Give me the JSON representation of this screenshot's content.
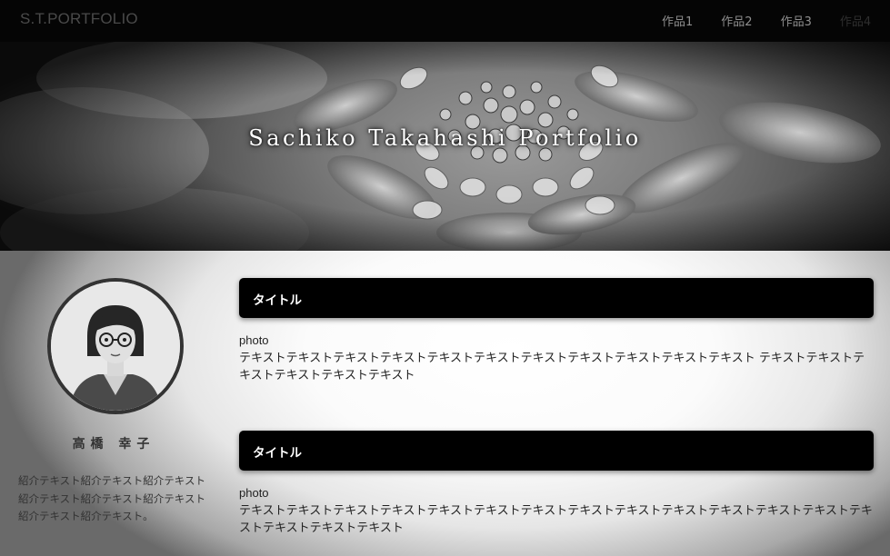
{
  "navbar": {
    "brand": "S.T.PORTFOLIO",
    "items": [
      "作品1",
      "作品2",
      "作品3",
      "作品4"
    ]
  },
  "hero": {
    "title": "Sachiko Takahashi Portfolio"
  },
  "profile": {
    "name": "高橋 幸子",
    "bio": "紹介テキスト紹介テキスト紹介テキスト紹介テキスト紹介テキスト紹介テキスト紹介テキスト紹介テキスト。"
  },
  "sections": [
    {
      "title": "タイトル",
      "photo_label": "photo",
      "text": "テキストテキストテキストテキストテキストテキストテキストテキストテキストテキストテキスト テキストテキストテキストテキストテキストテキスト"
    },
    {
      "title": "タイトル",
      "photo_label": "photo",
      "text": "テキストテキストテキストテキストテキストテキストテキストテキストテキストテキストテキストテキストテキストテキストテキストテキストテキスト"
    }
  ],
  "icons": {
    "avatar": "portrait-illustration",
    "hero": "flower-photo"
  }
}
